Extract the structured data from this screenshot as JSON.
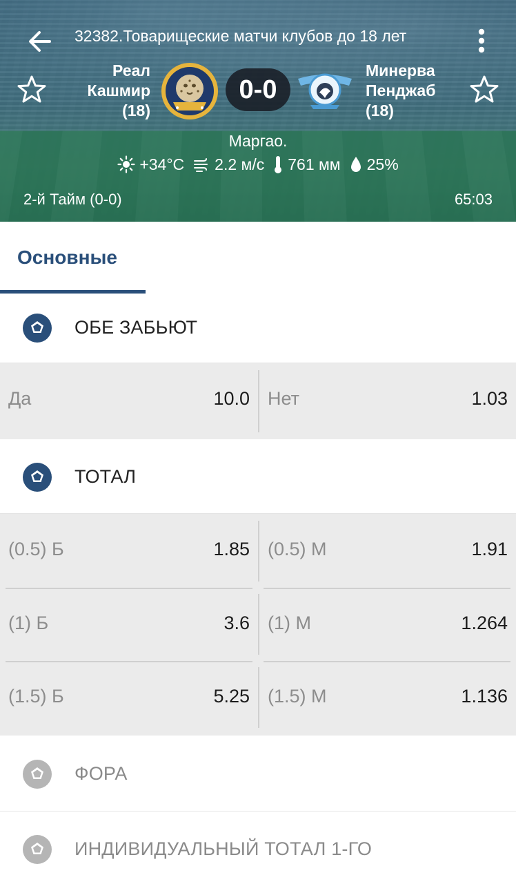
{
  "header": {
    "title": "32382.Товарищеские матчи клубов до 18 лет",
    "home_team": {
      "line1": "Реал",
      "line2": "Кашмир",
      "line3": "(18)",
      "logo_text_top": "REAL KASHMIR",
      "logo_text_bottom": "FC"
    },
    "away_team": {
      "line1": "Минерва",
      "line2": "Пенджаб",
      "line3": "(18)",
      "logo_text_top": "FC",
      "logo_text_mid": "MINERVA PUNJAB"
    },
    "score": "0-0",
    "venue": "Маргао.",
    "weather": {
      "temperature": "+34°C",
      "wind": "2.2 м/с",
      "pressure": "761 мм",
      "humidity": "25%"
    },
    "period": "2-й  Тайм (0-0)",
    "timer": "65:03"
  },
  "tabs": [
    {
      "label": "Основные",
      "active": true
    }
  ],
  "markets": {
    "both_score": {
      "title": "ОБЕ ЗАБЬЮТ",
      "odds": [
        {
          "label": "Да",
          "value": "10.0"
        },
        {
          "label": "Нет",
          "value": "1.03"
        }
      ]
    },
    "total": {
      "title": "ТОТАЛ",
      "rows": [
        [
          {
            "label": "(0.5) Б",
            "value": "1.85"
          },
          {
            "label": "(0.5) М",
            "value": "1.91"
          }
        ],
        [
          {
            "label": "(1) Б",
            "value": "3.6"
          },
          {
            "label": "(1) М",
            "value": "1.264"
          }
        ],
        [
          {
            "label": "(1.5) Б",
            "value": "5.25"
          },
          {
            "label": "(1.5) М",
            "value": "1.136"
          }
        ]
      ]
    },
    "handicap": {
      "title": "ФОРА"
    },
    "individual_total": {
      "title": "ИНДИВИДУАЛЬНЫЙ ТОТАЛ 1-ГО"
    }
  },
  "colors": {
    "accent": "#2a4f7a",
    "ball_active": "#2a4f7a",
    "ball_inactive": "#b5b5b5",
    "odds_bg": "#ebebeb"
  }
}
